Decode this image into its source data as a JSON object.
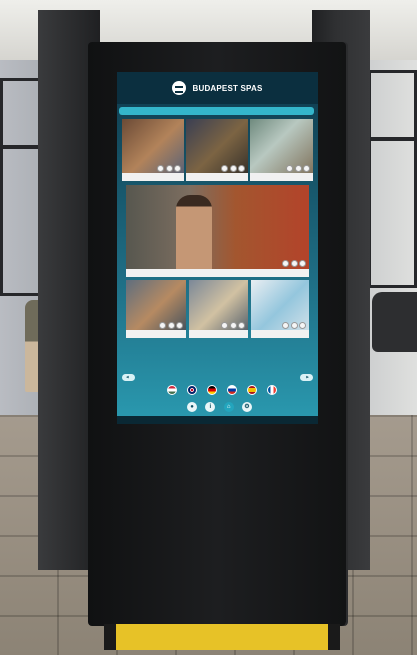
{
  "screen": {
    "brand": "BUDAPEST SPAS",
    "section_label": "",
    "tiles": [
      {
        "name": "tile-spa-interior",
        "caption": ""
      },
      {
        "name": "tile-spa-gallery",
        "caption": ""
      },
      {
        "name": "tile-aerial-bath",
        "caption": ""
      },
      {
        "name": "tile-featured-bather",
        "caption": ""
      },
      {
        "name": "tile-spa-guests",
        "caption": ""
      },
      {
        "name": "tile-spa-lounge",
        "caption": ""
      },
      {
        "name": "tile-spa-products",
        "caption": ""
      }
    ],
    "left_button": "",
    "right_button": "",
    "languages": [
      {
        "name": "hungarian",
        "color_a": "#cd2a3e",
        "color_b": "#436f4d"
      },
      {
        "name": "english",
        "color_a": "#012169",
        "color_b": "#c8102e"
      },
      {
        "name": "german",
        "color_a": "#000000",
        "color_b": "#ffce00"
      },
      {
        "name": "russian",
        "color_a": "#0039a6",
        "color_b": "#d52b1e"
      },
      {
        "name": "spanish",
        "color_a": "#aa151b",
        "color_b": "#f1bf00"
      },
      {
        "name": "french",
        "color_a": "#0055a4",
        "color_b": "#ef4135"
      }
    ],
    "footer_left": "",
    "footer_center": "",
    "footer_right": ""
  },
  "colors": {
    "kiosk_body": "#151617",
    "screen_header": "#0b2f3f",
    "accent_teal": "#34b6cb",
    "base_yellow": "#e7c227"
  }
}
